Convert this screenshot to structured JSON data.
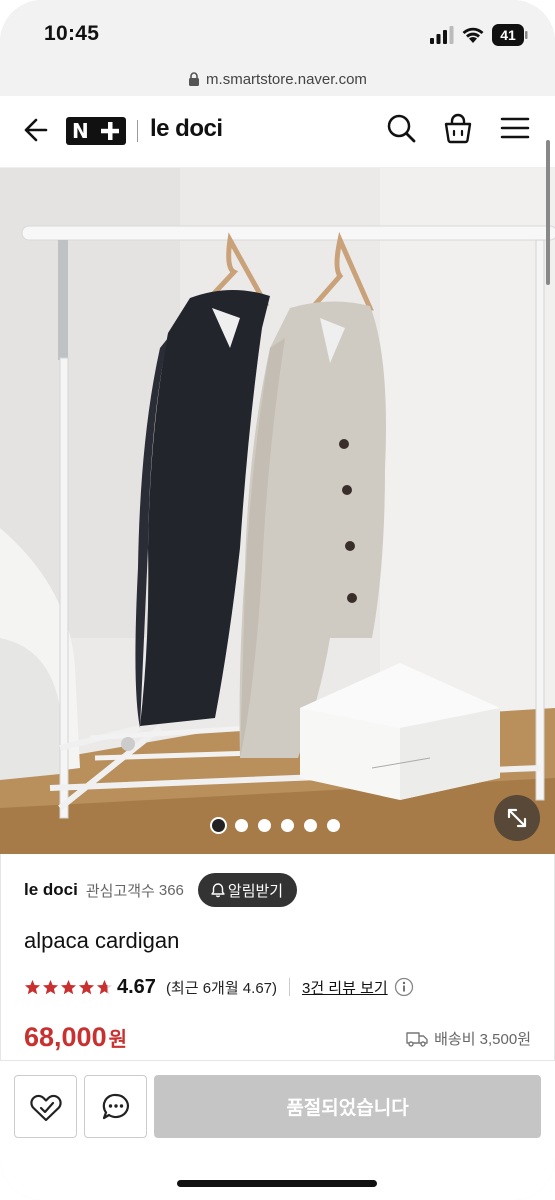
{
  "status_bar": {
    "time": "10:45",
    "battery": "41",
    "icons": [
      "signal-icon",
      "wifi-icon",
      "battery-icon"
    ]
  },
  "browser": {
    "url": "m.smartstore.naver.com"
  },
  "header": {
    "logo_text": "N",
    "store_name": "le doci",
    "icons": [
      "back-icon",
      "search-icon",
      "cart-icon",
      "menu-icon"
    ]
  },
  "gallery": {
    "image_count": 6,
    "active_index": 0
  },
  "store": {
    "name": "le doci",
    "followers_label": "관심고객수",
    "followers_count": "366",
    "notify_label": "알림받기"
  },
  "product": {
    "title": "alpaca cardigan",
    "rating": "4.67",
    "star_rating": 4.67,
    "recent_rating": "(최근 6개월 4.67)",
    "reviews_link": "3건 리뷰 보기",
    "price": "68,000",
    "price_unit": "원",
    "shipping": "배송비 3,500원"
  },
  "actions": {
    "soldout_label": "품절되었습니다"
  },
  "colors": {
    "price": "#c8312f",
    "star": "#c8312f",
    "soldout_bg": "#c5c5c5"
  }
}
